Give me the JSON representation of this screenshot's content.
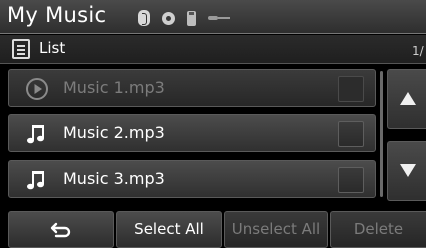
{
  "header": {
    "title": "My Music",
    "status_icons": [
      "bluetooth-icon",
      "disc-icon",
      "usb-icon",
      "aux-icon"
    ]
  },
  "listbar": {
    "label": "List",
    "page_indicator": "1/"
  },
  "tracks": [
    {
      "name": "Music 1.mp3",
      "icon": "play-circle-icon",
      "state": "playing"
    },
    {
      "name": "Music 2.mp3",
      "icon": "music-note-icon",
      "state": "normal"
    },
    {
      "name": "Music 3.mp3",
      "icon": "music-note-icon",
      "state": "normal"
    }
  ],
  "scroll": {
    "up_icon": "arrow-up-icon",
    "down_icon": "arrow-down-icon"
  },
  "bottom_bar": {
    "back_icon": "back-arrow-icon",
    "select_all": "Select All",
    "unselect_all": "Unselect All",
    "delete": "Delete"
  },
  "colors": {
    "background": "#000000",
    "button_top": "#4c4c4c",
    "button_bottom": "#2d2d2d",
    "disabled_text": "#7b7b7b"
  }
}
